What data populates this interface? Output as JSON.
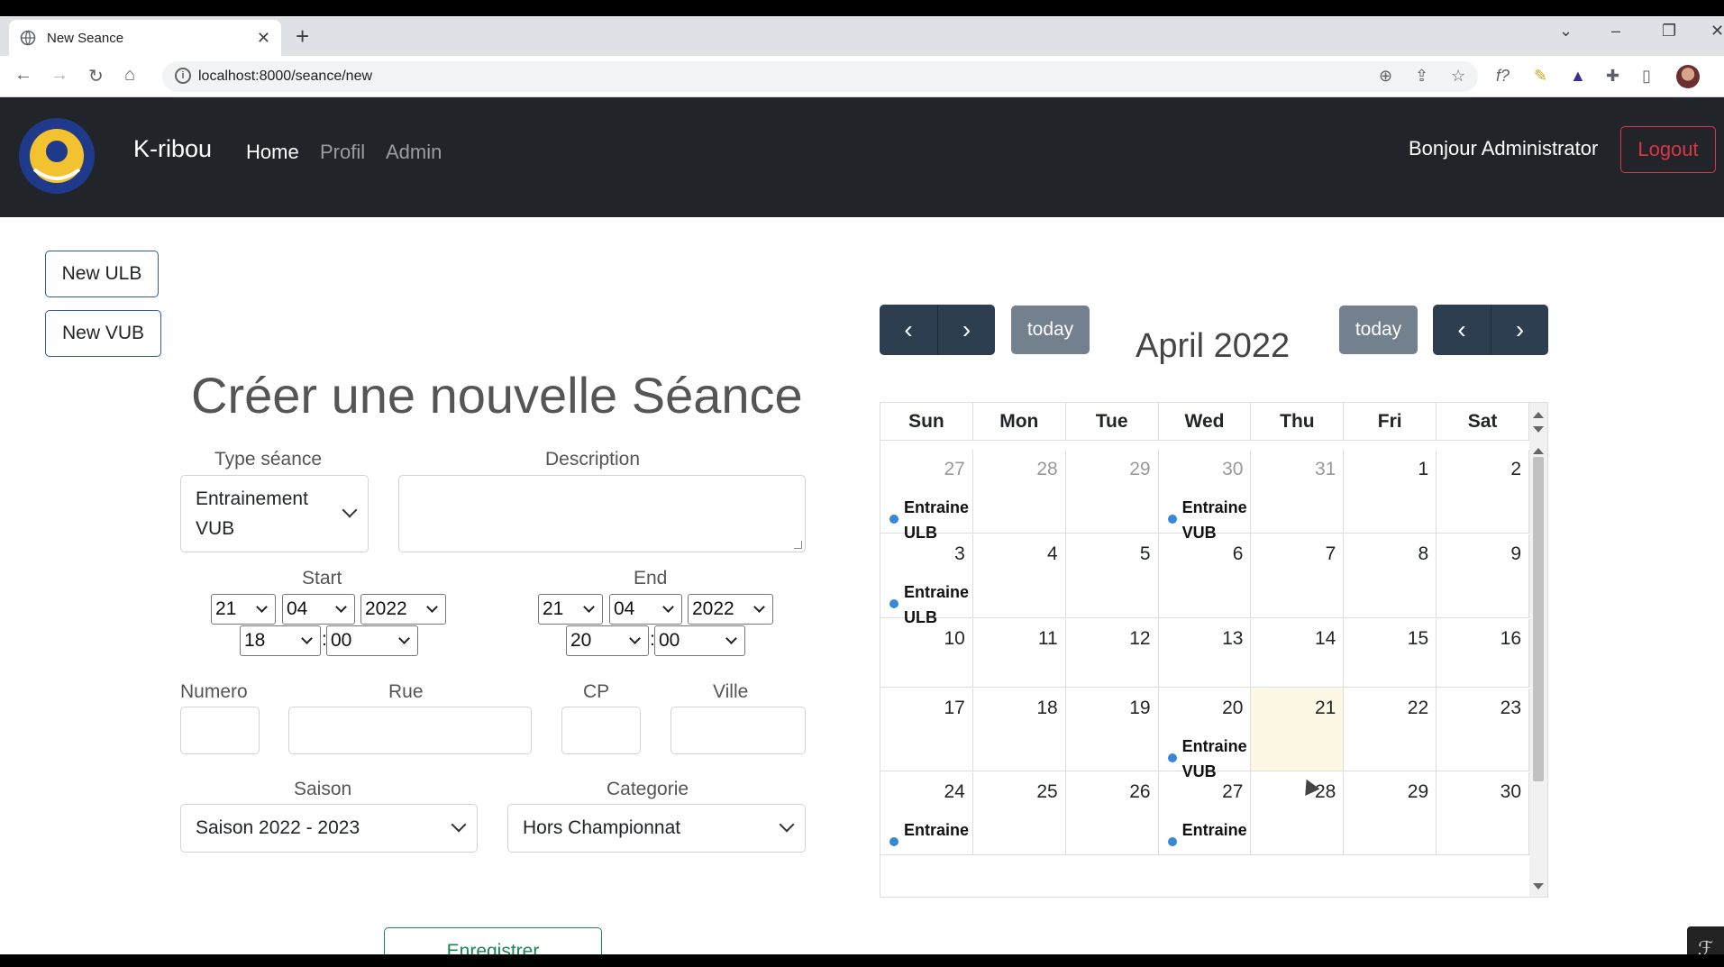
{
  "browser": {
    "tab_title": "New Seance",
    "url": "localhost:8000/seance/new"
  },
  "navbar": {
    "brand": "K-ribou",
    "links": [
      "Home",
      "Profil",
      "Admin"
    ],
    "greeting": "Bonjour Administrator",
    "logout": "Logout"
  },
  "left_buttons": {
    "new_ulb": "New ULB",
    "new_vub": "New VUB"
  },
  "form": {
    "title": "Créer une nouvelle Séance",
    "type_label": "Type séance",
    "type_value_line1": "Entrainement",
    "type_value_line2": "VUB",
    "description_label": "Description",
    "description_value": "",
    "start_label": "Start",
    "start": {
      "day": "21",
      "month": "04",
      "year": "2022",
      "hour": "18",
      "minute": "00"
    },
    "end_label": "End",
    "end": {
      "day": "21",
      "month": "04",
      "year": "2022",
      "hour": "20",
      "minute": "00"
    },
    "numero_label": "Numero",
    "rue_label": "Rue",
    "cp_label": "CP",
    "ville_label": "Ville",
    "saison_label": "Saison",
    "saison_value": "Saison 2022 - 2023",
    "categorie_label": "Categorie",
    "categorie_value": "Hors Championnat",
    "submit": "Enregistrer"
  },
  "calendar": {
    "title": "April 2022",
    "today_label": "today",
    "weekdays": [
      "Sun",
      "Mon",
      "Tue",
      "Wed",
      "Thu",
      "Fri",
      "Sat"
    ],
    "weeks": [
      [
        {
          "d": "27",
          "other": true,
          "ev": [
            "Entraine",
            "ULB"
          ]
        },
        {
          "d": "28",
          "other": true
        },
        {
          "d": "29",
          "other": true
        },
        {
          "d": "30",
          "other": true,
          "ev": [
            "Entraine",
            "VUB"
          ]
        },
        {
          "d": "31",
          "other": true
        },
        {
          "d": "1"
        },
        {
          "d": "2"
        }
      ],
      [
        {
          "d": "3",
          "ev": [
            "Entraine",
            "ULB"
          ]
        },
        {
          "d": "4"
        },
        {
          "d": "5"
        },
        {
          "d": "6"
        },
        {
          "d": "7"
        },
        {
          "d": "8"
        },
        {
          "d": "9"
        }
      ],
      [
        {
          "d": "10"
        },
        {
          "d": "11"
        },
        {
          "d": "12"
        },
        {
          "d": "13"
        },
        {
          "d": "14"
        },
        {
          "d": "15"
        },
        {
          "d": "16"
        }
      ],
      [
        {
          "d": "17"
        },
        {
          "d": "18"
        },
        {
          "d": "19"
        },
        {
          "d": "20",
          "ev": [
            "Entraine",
            "VUB"
          ]
        },
        {
          "d": "21",
          "today": true
        },
        {
          "d": "22"
        },
        {
          "d": "23"
        }
      ],
      [
        {
          "d": "24",
          "ev": [
            "Entraine"
          ]
        },
        {
          "d": "25"
        },
        {
          "d": "26"
        },
        {
          "d": "27",
          "ev": [
            "Entraine"
          ]
        },
        {
          "d": "28"
        },
        {
          "d": "29"
        },
        {
          "d": "30"
        }
      ]
    ],
    "event_color": "#3788d8",
    "today_color": "#fcf8e3"
  },
  "colors": {
    "navbar_bg": "#212529",
    "calendar_button_bg": "#2c3e50",
    "logout_red": "#dc3545",
    "submit_green": "#198754"
  }
}
